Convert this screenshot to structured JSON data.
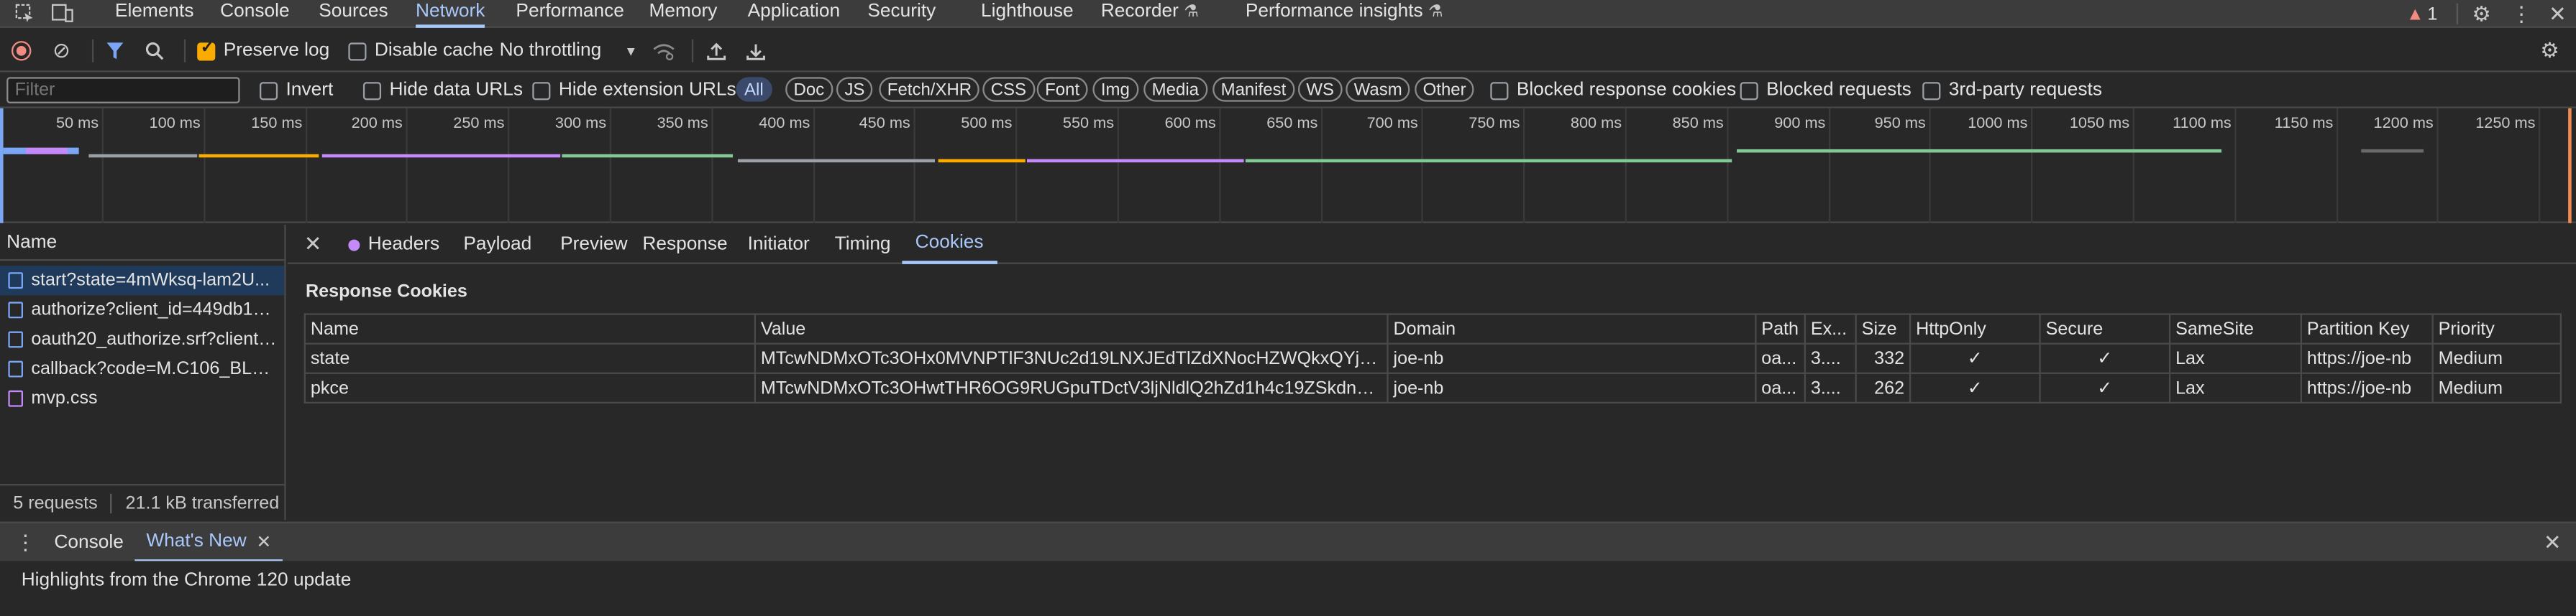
{
  "topbar": {
    "tabs": [
      "Elements",
      "Console",
      "Sources",
      "Network",
      "Performance",
      "Memory",
      "Application",
      "Security",
      "Lighthouse",
      "Recorder",
      "Performance insights"
    ],
    "active_tab": "Network",
    "issues_count": "1"
  },
  "toolbar": {
    "preserve_log": "Preserve log",
    "disable_cache": "Disable cache",
    "throttling": "No throttling"
  },
  "filterbar": {
    "placeholder": "Filter",
    "invert": "Invert",
    "hide_data_urls": "Hide data URLs",
    "hide_extension_urls": "Hide extension URLs",
    "chips": [
      "All",
      "Doc",
      "JS",
      "Fetch/XHR",
      "CSS",
      "Font",
      "Img",
      "Media",
      "Manifest",
      "WS",
      "Wasm",
      "Other"
    ],
    "blocked_response_cookies": "Blocked response cookies",
    "blocked_requests": "Blocked requests",
    "third_party_requests": "3rd-party requests"
  },
  "overview": {
    "ticks": [
      "50 ms",
      "100 ms",
      "150 ms",
      "200 ms",
      "250 ms",
      "300 ms",
      "350 ms",
      "400 ms",
      "450 ms",
      "500 ms",
      "550 ms",
      "600 ms",
      "650 ms",
      "700 ms",
      "750 ms",
      "800 ms",
      "850 ms",
      "900 ms",
      "950 ms",
      "1000 ms",
      "1050 ms",
      "1100 ms",
      "1150 ms",
      "1200 ms",
      "1250 ms"
    ]
  },
  "requests": {
    "header": "Name",
    "items": [
      {
        "name": "start?state=4mWksq-lam2U...",
        "type": "doc"
      },
      {
        "name": "authorize?client_id=449db15...",
        "type": "doc"
      },
      {
        "name": "oauth20_authorize.srf?client_...",
        "type": "doc"
      },
      {
        "name": "callback?code=M.C106_BL2....",
        "type": "doc"
      },
      {
        "name": "mvp.css",
        "type": "css"
      }
    ],
    "count": "5 requests",
    "transferred": "21.1 kB transferred"
  },
  "details": {
    "tabs": [
      "Headers",
      "Payload",
      "Preview",
      "Response",
      "Initiator",
      "Timing",
      "Cookies"
    ],
    "active_tab": "Cookies",
    "section_title": "Response Cookies",
    "columns": [
      "Name",
      "Value",
      "Domain",
      "Path",
      "Ex...",
      "Size",
      "HttpOnly",
      "Secure",
      "SameSite",
      "Partition Key",
      "Priority"
    ],
    "rows": [
      [
        "state",
        "MTcwNDMxOTc3OHx0MVNPTlF3NUc2d19LNXJEdTlZdXNocHZWQkxQYjh2V...",
        "joe-nb",
        "oa...",
        "3....",
        "332",
        "✓",
        "✓",
        "Lax",
        "https://joe-nb",
        "Medium"
      ],
      [
        "pkce",
        "MTcwNDMxOTc3OHwtTHR6OG9RUGpuTDctV3ljNldlQ2hZd1h4c19ZSkdnbkV...",
        "joe-nb",
        "oa...",
        "3....",
        "262",
        "✓",
        "✓",
        "Lax",
        "https://joe-nb",
        "Medium"
      ]
    ]
  },
  "drawer": {
    "tabs": [
      "Console",
      "What's New"
    ],
    "active_tab": "What's New",
    "message": "Highlights from the Chrome 120 update"
  }
}
